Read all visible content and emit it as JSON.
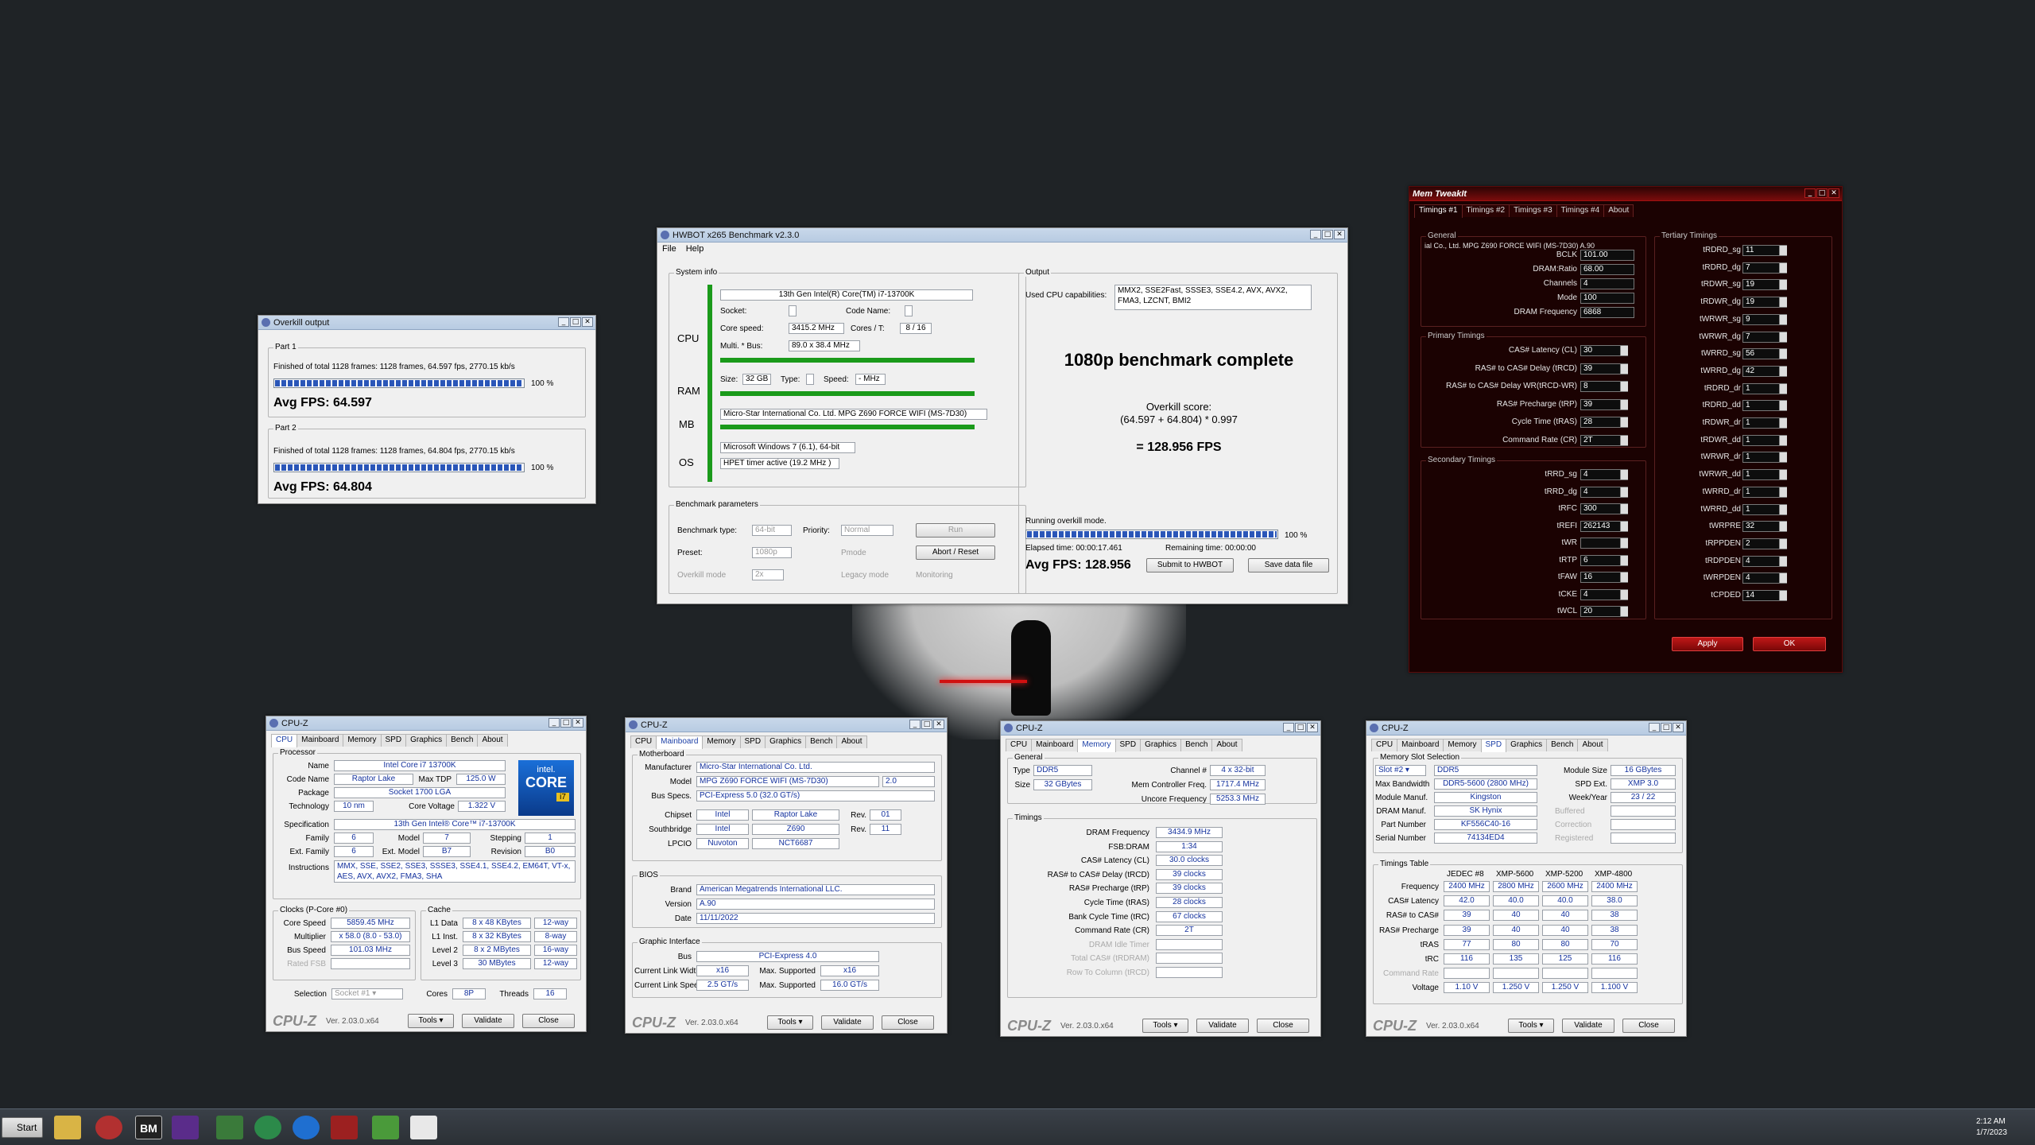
{
  "overkill": {
    "title": "Overkill output",
    "part1_label": "Part 1",
    "part1_line": "Finished of total 1128 frames: 1128 frames, 64.597 fps,  2770.15 kb/s",
    "part1_pct": "100 %",
    "part1_progress": 1.0,
    "part1_avg": "Avg FPS: 64.597",
    "part2_label": "Part 2",
    "part2_line": "Finished of total 1128 frames: 1128 frames, 64.804 fps,  2770.15 kb/s",
    "part2_pct": "100 %",
    "part2_progress": 1.0,
    "part2_avg": "Avg FPS: 64.804"
  },
  "hwbot": {
    "title": "HWBOT x265 Benchmark v2.3.0",
    "menu_file": "File",
    "menu_help": "Help",
    "sysinfo_label": "System info",
    "cpu_label": "CPU",
    "ram_label": "RAM",
    "mb_label": "MB",
    "os_label": "OS",
    "cpu_name": "13th Gen Intel(R) Core(TM) i7-13700K",
    "socket_label": "Socket:",
    "codename_label": "Code Name:",
    "corespeed_label": "Core speed:",
    "corespeed": "3415.2 MHz",
    "cores_label": "Cores / T:",
    "cores": "8 / 16",
    "multi_label": "Multi. * Bus:",
    "multi": "89.0 x 38.4 MHz",
    "size_label": "Size:",
    "size": "32 GB",
    "type_label": "Type:",
    "speed_label": "Speed:",
    "speed": "- MHz",
    "mb": "Micro-Star International Co. Ltd. MPG Z690 FORCE WIFI (MS-7D30)",
    "os": "Microsoft Windows 7 (6.1), 64-bit",
    "hpet": "HPET timer active (19.2 MHz )",
    "params_label": "Benchmark parameters",
    "bench_type_label": "Benchmark type:",
    "bench_type": "64-bit",
    "priority_label": "Priority:",
    "priority": "Normal",
    "run": "Run",
    "preset_label": "Preset:",
    "preset": "1080p",
    "pmode": "Pmode",
    "abort": "Abort / Reset",
    "overkill_mode": "Overkill mode",
    "overkill_mult": "2x",
    "legacy": "Legacy mode",
    "monitoring": "Monitoring",
    "output_label": "Output",
    "caps_label": "Used CPU capabilities:",
    "caps": "MMX2, SSE2Fast, SSSE3, SSE4.2, AVX, AVX2, FMA3, LZCNT, BMI2",
    "complete": "1080p benchmark complete",
    "score_label": "Overkill score:",
    "score_formula": "(64.597 + 64.804) * 0.997",
    "score_result": "= 128.956 FPS",
    "running": "Running overkill mode.",
    "pct": "100 %",
    "progress": 1.0,
    "elapsed": "Elapsed time: 00:00:17.461",
    "remaining": "Remaining time: 00:00:00",
    "avg": "Avg FPS: 128.956",
    "submit": "Submit to HWBOT",
    "save": "Save data file"
  },
  "memtweak": {
    "title": "Mem TweakIt",
    "tabs": [
      "Timings #1",
      "Timings #2",
      "Timings #3",
      "Timings #4",
      "About"
    ],
    "general_label": "General",
    "board": "ial Co., Ltd. MPG Z690 FORCE WIFI (MS-7D30) A.90",
    "general": [
      {
        "k": "BCLK",
        "v": "101.00"
      },
      {
        "k": "DRAM:Ratio",
        "v": "68.00"
      },
      {
        "k": "Channels",
        "v": "4"
      },
      {
        "k": "Mode",
        "v": "100"
      },
      {
        "k": "DRAM Frequency",
        "v": "6868"
      }
    ],
    "primary_label": "Primary Timings",
    "primary": [
      {
        "k": "CAS# Latency (CL)",
        "v": "30"
      },
      {
        "k": "RAS# to CAS# Delay (tRCD)",
        "v": "39"
      },
      {
        "k": "RAS# to CAS# Delay WR(tRCD-WR)",
        "v": "8"
      },
      {
        "k": "RAS# Precharge (tRP)",
        "v": "39"
      },
      {
        "k": "Cycle Time (tRAS)",
        "v": "28"
      },
      {
        "k": "Command Rate (CR)",
        "v": "2T"
      }
    ],
    "secondary_label": "Secondary Timings",
    "secondary": [
      {
        "k": "tRRD_sg",
        "v": "4"
      },
      {
        "k": "tRRD_dg",
        "v": "4"
      },
      {
        "k": "tRFC",
        "v": "300"
      },
      {
        "k": "tREFI",
        "v": "262143"
      },
      {
        "k": "tWR",
        "v": ""
      },
      {
        "k": "tRTP",
        "v": "6"
      },
      {
        "k": "tFAW",
        "v": "16"
      },
      {
        "k": "tCKE",
        "v": "4"
      },
      {
        "k": "tWCL",
        "v": "20"
      }
    ],
    "tertiary_label": "Tertiary Timings",
    "tertiary": [
      {
        "k": "tRDRD_sg",
        "v": "11"
      },
      {
        "k": "tRDRD_dg",
        "v": "7"
      },
      {
        "k": "tRDWR_sg",
        "v": "19"
      },
      {
        "k": "tRDWR_dg",
        "v": "19"
      },
      {
        "k": "tWRWR_sg",
        "v": "9"
      },
      {
        "k": "tWRWR_dg",
        "v": "7"
      },
      {
        "k": "tWRRD_sg",
        "v": "56"
      },
      {
        "k": "tWRRD_dg",
        "v": "42"
      },
      {
        "k": "tRDRD_dr",
        "v": "1"
      },
      {
        "k": "tRDRD_dd",
        "v": "1"
      },
      {
        "k": "tRDWR_dr",
        "v": "1"
      },
      {
        "k": "tRDWR_dd",
        "v": "1"
      },
      {
        "k": "tWRWR_dr",
        "v": "1"
      },
      {
        "k": "tWRWR_dd",
        "v": "1"
      },
      {
        "k": "tWRRD_dr",
        "v": "1"
      },
      {
        "k": "tWRRD_dd",
        "v": "1"
      },
      {
        "k": "tWRPRE",
        "v": "32"
      },
      {
        "k": "tRPPDEN",
        "v": "2"
      },
      {
        "k": "tRDPDEN",
        "v": "4"
      },
      {
        "k": "tWRPDEN",
        "v": "4"
      },
      {
        "k": "tCPDED",
        "v": "14"
      }
    ],
    "apply": "Apply",
    "ok": "OK"
  },
  "cpuz_common": {
    "title": "CPU-Z",
    "tabs": [
      "CPU",
      "Mainboard",
      "Memory",
      "SPD",
      "Graphics",
      "Bench",
      "About"
    ],
    "logo": "CPU-Z",
    "ver": "Ver. 2.03.0.x64",
    "tools": "Tools",
    "validate": "Validate",
    "close": "Close"
  },
  "cpuz1": {
    "processor_label": "Processor",
    "name_label": "Name",
    "name": "Intel Core i7 13700K",
    "codename_label": "Code Name",
    "codename": "Raptor Lake",
    "tdp_label": "Max TDP",
    "tdp": "125.0 W",
    "package_label": "Package",
    "package": "Socket 1700 LGA",
    "tech_label": "Technology",
    "tech": "10 nm",
    "voltage_label": "Core Voltage",
    "voltage": "1.322 V",
    "spec_label": "Specification",
    "spec": "13th Gen Intel® Core™ i7-13700K",
    "family_label": "Family",
    "family": "6",
    "model_label": "Model",
    "model": "7",
    "stepping_label": "Stepping",
    "stepping": "1",
    "extfam_label": "Ext. Family",
    "extfam": "6",
    "extmodel_label": "Ext. Model",
    "extmodel": "B7",
    "revision_label": "Revision",
    "revision": "B0",
    "instr_label": "Instructions",
    "instr": "MMX, SSE, SSE2, SSE3, SSSE3, SSE4.1, SSE4.2, EM64T, VT-x, AES, AVX, AVX2, FMA3, SHA",
    "clocks_label": "Clocks (P-Core #0)",
    "corespeed_label": "Core Speed",
    "corespeed": "5859.45 MHz",
    "mult_label": "Multiplier",
    "mult": "x 58.0 (8.0 - 53.0)",
    "bus_label": "Bus Speed",
    "bus": "101.03 MHz",
    "fsb_label": "Rated FSB",
    "cache_label": "Cache",
    "l1d_label": "L1 Data",
    "l1d": "8 x 48 KBytes",
    "l1d_w": "12-way",
    "l1i_label": "L1 Inst.",
    "l1i": "8 x 32 KBytes",
    "l1i_w": "8-way",
    "l2_label": "Level 2",
    "l2": "8 x 2 MBytes",
    "l2_w": "16-way",
    "l3_label": "Level 3",
    "l3": "30 MBytes",
    "l3_w": "12-way",
    "sel_label": "Selection",
    "sel": "Socket #1",
    "cores_label": "Cores",
    "cores": "8P",
    "threads_label": "Threads",
    "threads": "16",
    "intel1": "intel.",
    "intel2": "CORE",
    "intel3": "i7"
  },
  "cpuz2": {
    "mb_label": "Motherboard",
    "manuf_label": "Manufacturer",
    "manuf": "Micro-Star International Co. Ltd.",
    "model_label": "Model",
    "model": "MPG Z690 FORCE WIFI (MS-7D30)",
    "model_rev": "2.0",
    "busspec_label": "Bus Specs.",
    "busspec": "PCI-Express 5.0 (32.0 GT/s)",
    "chipset_label": "Chipset",
    "chipset": "Intel",
    "chipset2": "Raptor Lake",
    "rev_label": "Rev.",
    "chipset_rev": "01",
    "south_label": "Southbridge",
    "south": "Intel",
    "south2": "Z690",
    "south_rev": "11",
    "lpcio_label": "LPCIO",
    "lpcio": "Nuvoton",
    "lpcio2": "NCT6687",
    "bios_label": "BIOS",
    "brand_label": "Brand",
    "brand": "American Megatrends International LLC.",
    "ver_label": "Version",
    "ver": "A.90",
    "date_label": "Date",
    "date": "11/11/2022",
    "gi_label": "Graphic Interface",
    "gbus_label": "Bus",
    "gbus": "PCI-Express 4.0",
    "clw_label": "Current Link Width",
    "clw": "x16",
    "msup_label": "Max. Supported",
    "msw": "x16",
    "cls_label": "Current Link Speed",
    "cls": "2.5 GT/s",
    "mss": "16.0 GT/s"
  },
  "cpuz3": {
    "general_label": "General",
    "type_label": "Type",
    "type": "DDR5",
    "channel_label": "Channel #",
    "channel": "4 x 32-bit",
    "size_label": "Size",
    "size": "32 GBytes",
    "mcf_label": "Mem Controller Freq.",
    "mcf": "1717.4 MHz",
    "uf_label": "Uncore Frequency",
    "uf": "5253.3 MHz",
    "timings_label": "Timings",
    "rows": [
      {
        "k": "DRAM Frequency",
        "v": "3434.9 MHz"
      },
      {
        "k": "FSB:DRAM",
        "v": "1:34"
      },
      {
        "k": "CAS# Latency (CL)",
        "v": "30.0 clocks"
      },
      {
        "k": "RAS# to CAS# Delay (tRCD)",
        "v": "39 clocks"
      },
      {
        "k": "RAS# Precharge (tRP)",
        "v": "39 clocks"
      },
      {
        "k": "Cycle Time (tRAS)",
        "v": "28 clocks"
      },
      {
        "k": "Bank Cycle Time (tRC)",
        "v": "67 clocks"
      },
      {
        "k": "Command Rate (CR)",
        "v": "2T"
      },
      {
        "k": "DRAM Idle Timer",
        "v": ""
      },
      {
        "k": "Total CAS# (tRDRAM)",
        "v": ""
      },
      {
        "k": "Row To Column (tRCD)",
        "v": ""
      }
    ]
  },
  "cpuz4": {
    "slotsel_label": "Memory Slot Selection",
    "slot": "Slot #2",
    "slottype": "DDR5",
    "modsize_label": "Module Size",
    "modsize": "16 GBytes",
    "maxbw_label": "Max Bandwidth",
    "maxbw": "DDR5-5600 (2800 MHz)",
    "spdext_label": "SPD Ext.",
    "spdext": "XMP 3.0",
    "mmanuf_label": "Module Manuf.",
    "mmanuf": "Kingston",
    "wy_label": "Week/Year",
    "wy": "23 / 22",
    "dmanuf_label": "DRAM Manuf.",
    "dmanuf": "SK Hynix",
    "buffered": "Buffered",
    "pn_label": "Part Number",
    "pn": "KF556C40-16",
    "correction": "Correction",
    "sn_label": "Serial Number",
    "sn": "74134ED4",
    "registered": "Registered",
    "tt_label": "Timings Table",
    "cols": [
      "JEDEC #8",
      "XMP-5600",
      "XMP-5200",
      "XMP-4800"
    ],
    "rows": [
      {
        "k": "Frequency",
        "v": [
          "2400 MHz",
          "2800 MHz",
          "2600 MHz",
          "2400 MHz"
        ]
      },
      {
        "k": "CAS# Latency",
        "v": [
          "42.0",
          "40.0",
          "40.0",
          "38.0"
        ]
      },
      {
        "k": "RAS# to CAS#",
        "v": [
          "39",
          "40",
          "40",
          "38"
        ]
      },
      {
        "k": "RAS# Precharge",
        "v": [
          "39",
          "40",
          "40",
          "38"
        ]
      },
      {
        "k": "tRAS",
        "v": [
          "77",
          "80",
          "80",
          "70"
        ]
      },
      {
        "k": "tRC",
        "v": [
          "116",
          "135",
          "125",
          "116"
        ]
      },
      {
        "k": "Command Rate",
        "v": [
          "",
          "",
          "",
          ""
        ]
      },
      {
        "k": "Voltage",
        "v": [
          "1.10 V",
          "1.250 V",
          "1.250 V",
          "1.100 V"
        ]
      }
    ]
  },
  "taskbar": {
    "start": "Start",
    "time": "2:12 AM",
    "date": "1/7/2023"
  },
  "colors": {
    "desktop": "#1f2326",
    "green": "#1a9a1a",
    "progress": "#2a56b8",
    "mt_bg": "#1b0202",
    "cpuz_value": "#14329e"
  }
}
